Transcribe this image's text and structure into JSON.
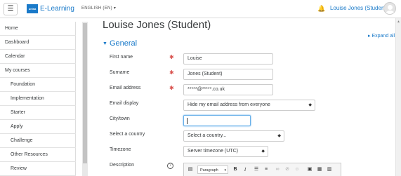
{
  "header": {
    "menu_icon": "hamburger-icon",
    "brand": "E-Learning",
    "logo_text": "unisa",
    "language": "ENGLISH (EN) ▾",
    "notifications_icon": "bell-icon",
    "user_name": "Louise Jones (Student)"
  },
  "sidebar": {
    "items": [
      {
        "label": "Home",
        "level": 0
      },
      {
        "label": "Dashboard",
        "level": 0
      },
      {
        "label": "Calendar",
        "level": 0
      },
      {
        "label": "My courses",
        "level": 0
      },
      {
        "label": "Foundation",
        "level": 1
      },
      {
        "label": "Implementation",
        "level": 1
      },
      {
        "label": "Starter",
        "level": 1
      },
      {
        "label": "Apply",
        "level": 1
      },
      {
        "label": "Challenge",
        "level": 1
      },
      {
        "label": "Other Resources",
        "level": 1
      },
      {
        "label": "Review",
        "level": 1
      }
    ]
  },
  "page": {
    "title": "Louise Jones (Student)",
    "expand_all": "Expand all",
    "section_title": "General"
  },
  "form": {
    "first_name": {
      "label": "First name",
      "value": "Louise",
      "required": true
    },
    "surname": {
      "label": "Surname",
      "value": "Jones (Student)",
      "required": true
    },
    "email": {
      "label": "Email address",
      "value": "*****@*****.co.uk",
      "required": true
    },
    "email_display": {
      "label": "Email display",
      "value": "Hide my email address from everyone"
    },
    "city": {
      "label": "City/town",
      "value": ""
    },
    "country": {
      "label": "Select a country",
      "value": "Select a country..."
    },
    "timezone": {
      "label": "Timezone",
      "value": "Server timezone (UTC)"
    },
    "description": {
      "label": "Description",
      "help_icon": "help-icon"
    }
  },
  "editor": {
    "paragraph": "Paragraph",
    "bold": "B",
    "italic": "I"
  },
  "colors": {
    "accent": "#1a7ac9",
    "required": "#d9534f",
    "focus": "#66afe9"
  }
}
